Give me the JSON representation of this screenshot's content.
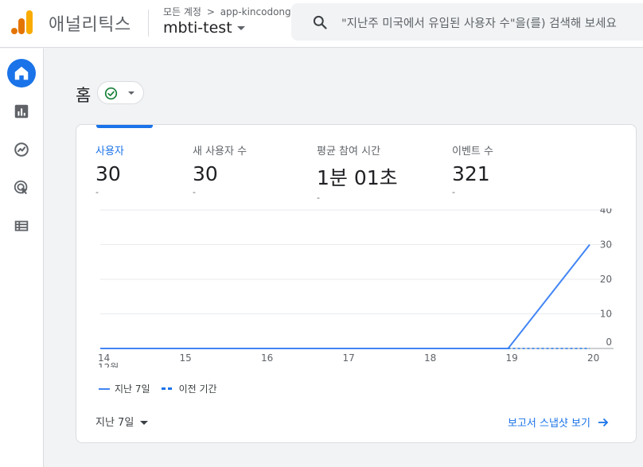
{
  "header": {
    "app_name": "애널리틱스",
    "breadcrumb": {
      "account": "모든 계정",
      "separator": ">",
      "sub": "app-kincodong"
    },
    "property": "mbti-test",
    "search_placeholder": "\"지난주 미국에서 유입된 사용자 수\"을(를) 검색해 보세요"
  },
  "rail": {
    "items": [
      {
        "icon": "home-icon",
        "active": true
      },
      {
        "icon": "reports-icon"
      },
      {
        "icon": "explore-icon"
      },
      {
        "icon": "advertising-icon"
      },
      {
        "icon": "configure-icon"
      }
    ]
  },
  "page": {
    "title": "홈"
  },
  "metrics": [
    {
      "label": "사용자",
      "value": "30",
      "delta": "-"
    },
    {
      "label": "새 사용자 수",
      "value": "30",
      "delta": "-"
    },
    {
      "label": "평균 참여 시간",
      "value": "1분 01초",
      "delta": "-"
    },
    {
      "label": "이벤트 수",
      "value": "321",
      "delta": "-"
    }
  ],
  "chart_data": {
    "type": "line",
    "x": [
      "14",
      "15",
      "16",
      "17",
      "18",
      "19",
      "20"
    ],
    "x_month_label": "12월",
    "ylim": [
      0,
      40
    ],
    "yticks": [
      0,
      10,
      20,
      30,
      40
    ],
    "grid": true,
    "series": [
      {
        "name": "지난 7일",
        "values": [
          0,
          0,
          0,
          0,
          0,
          0,
          30
        ],
        "style": "solid",
        "color": "#4285f4"
      },
      {
        "name": "이전 기간",
        "values": [
          null,
          null,
          null,
          null,
          null,
          0,
          0
        ],
        "style": "dashed",
        "color": "#1a73e8"
      }
    ]
  },
  "footer": {
    "date_range": "지난 7일",
    "snapshot_link": "보고서 스냅샷 보기"
  },
  "colors": {
    "accent": "#1a73e8",
    "logo_orange": "#f9ab00",
    "logo_dark": "#e37400"
  }
}
